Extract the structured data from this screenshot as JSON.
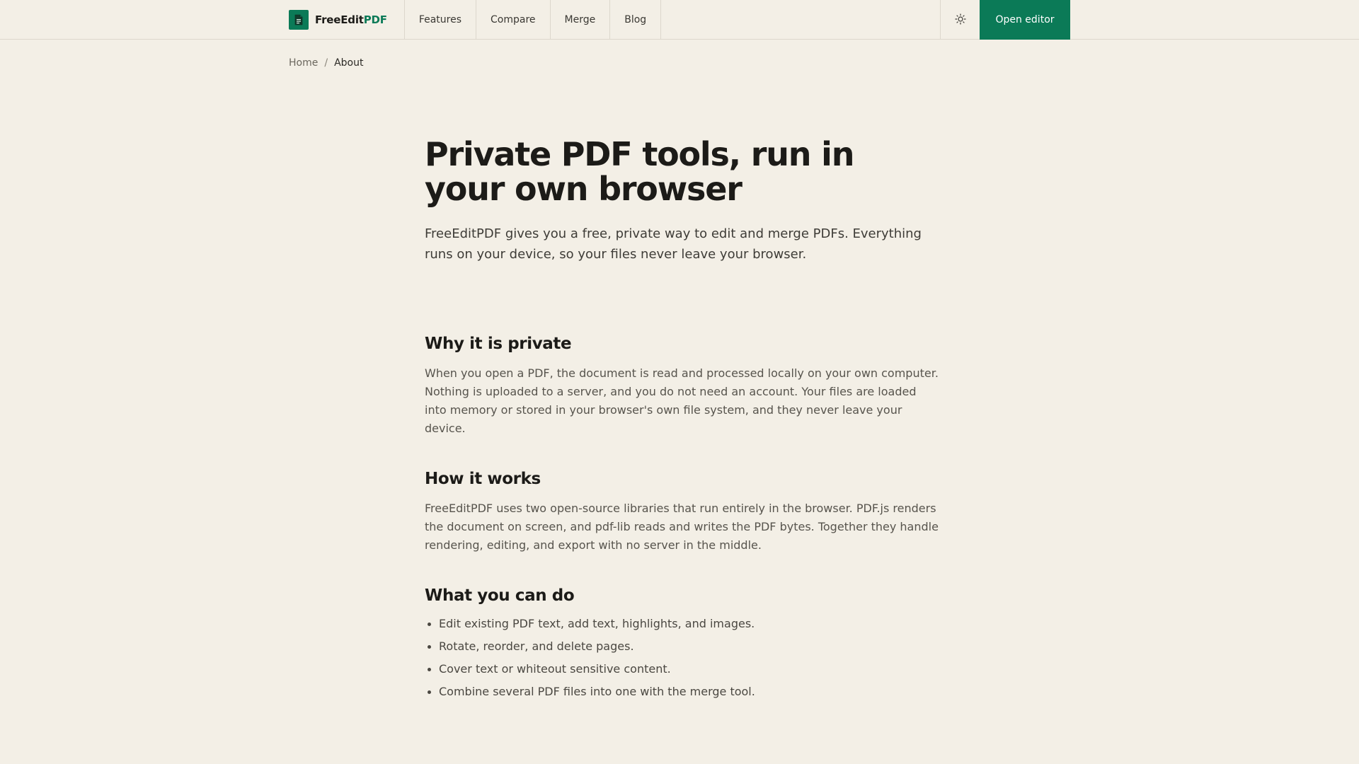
{
  "header": {
    "brand_part1": "FreeEdit",
    "brand_part2": "PDF",
    "nav": [
      {
        "label": "Features"
      },
      {
        "label": "Compare"
      },
      {
        "label": "Merge"
      },
      {
        "label": "Blog"
      }
    ],
    "theme_icon": "sun-icon",
    "cta_label": "Open editor"
  },
  "breadcrumb": {
    "home": "Home",
    "separator": "/",
    "current": "About"
  },
  "hero": {
    "title": "Private PDF tools, run in your own browser",
    "lede": "FreeEditPDF gives you a free, private way to edit and merge PDFs. Everything runs on your device, so your files never leave your browser."
  },
  "sections": [
    {
      "title": "Why it is private",
      "body": "When you open a PDF, the document is read and processed locally on your own computer. Nothing is uploaded to a server, and you do not need an account. Your files are loaded into memory or stored in your browser's own file system, and they never leave your device."
    },
    {
      "title": "How it works",
      "body": "FreeEditPDF uses two open-source libraries that run entirely in the browser. PDF.js renders the document on screen, and pdf-lib reads and writes the PDF bytes. Together they handle rendering, editing, and export with no server in the middle."
    },
    {
      "title": "What you can do",
      "items": [
        "Edit existing PDF text, add text, highlights, and images.",
        "Rotate, reorder, and delete pages.",
        "Cover text or whiteout sensitive content.",
        "Combine several PDF files into one with the merge tool."
      ]
    }
  ],
  "colors": {
    "background": "#f3efe6",
    "brand_green": "#0b7a57",
    "text": "#1c1b18"
  }
}
